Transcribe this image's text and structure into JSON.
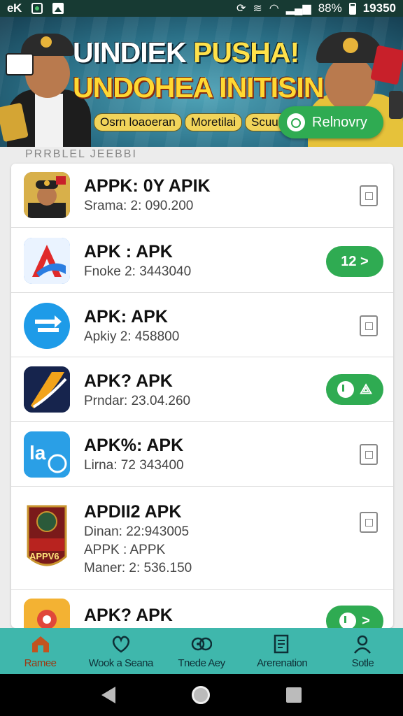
{
  "status_bar": {
    "carrier": "eK",
    "battery": "88%",
    "time": "19350"
  },
  "banner": {
    "title_line1_a": "UINDIEK ",
    "title_line1_b": "PUSHA!",
    "title_line2": "UNDOHEA INITISIN",
    "sub_items": [
      "Osrn loaoeran",
      "Moretilai",
      "Scuus"
    ],
    "button_label": "Relnovry"
  },
  "section": {
    "heading": "PRRBLEL JEEBBI"
  },
  "apps": [
    {
      "title": "APPK: 0Y APIK",
      "subtitle": "Srama: 2: 090.200",
      "action": "plain",
      "icon": "officer-portrait-icon"
    },
    {
      "title": "APK : APK",
      "subtitle": "Fnoke 2: 3443040",
      "action": "green",
      "action_label": "12 >",
      "icon": "red-a-logo-icon"
    },
    {
      "title": "APK: APK",
      "subtitle": "Apkiy 2: 458800",
      "action": "plain",
      "icon": "blue-arrow-logo-icon"
    },
    {
      "title": "APK? APK",
      "subtitle": "Prndar: 23.04.260",
      "action": "green",
      "action_label": "",
      "icon": "dark-swoosh-logo-icon"
    },
    {
      "title": "APK%: APK",
      "subtitle": "Lirna: 72 343400",
      "action": "plain",
      "icon": "blue-tag-logo-icon"
    },
    {
      "title": "APDII2 APK",
      "subtitle": "Dinan: 22:943005",
      "subtitle2": "APPK : APPK",
      "subtitle3": "Maner: 2: 536.150",
      "action": "plain",
      "icon": "emblem-shield-icon",
      "icon_text": "APPV6"
    },
    {
      "title": "APK? APK",
      "subtitle": "",
      "action": "green",
      "action_label": ">",
      "icon": "orange-pin-logo-icon"
    }
  ],
  "tabs": [
    {
      "label": "Ramee",
      "icon": "home-icon",
      "active": true
    },
    {
      "label": "Wook a Seana",
      "icon": "heart-icon",
      "active": false
    },
    {
      "label": "Tnede Aey",
      "icon": "game-controller-icon",
      "active": false
    },
    {
      "label": "Arerenation",
      "icon": "document-icon",
      "active": false
    },
    {
      "label": "Sotle",
      "icon": "profile-icon",
      "active": false
    }
  ],
  "colors": {
    "accent_green": "#2fab52",
    "tab_bar": "#3fb7ac",
    "status_bar": "#173a33"
  }
}
